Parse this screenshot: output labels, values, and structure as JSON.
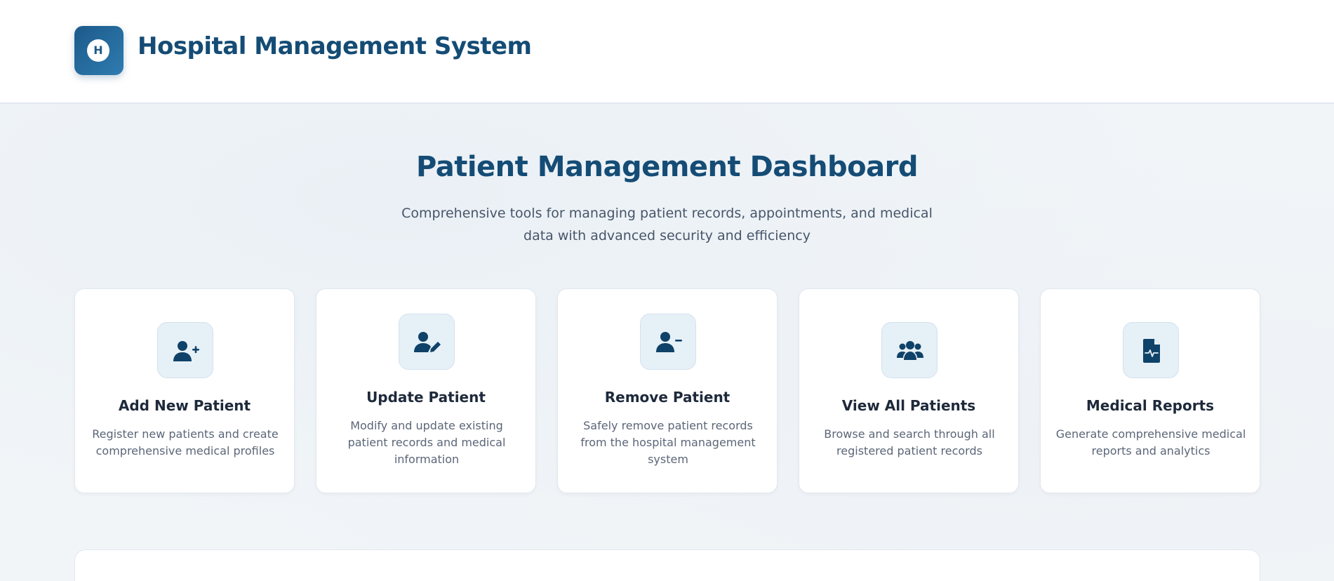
{
  "header": {
    "logo_letter": "H",
    "app_title": "Hospital Management System"
  },
  "main": {
    "title": "Patient Management Dashboard",
    "subtitle": "Comprehensive tools for managing patient records, appointments, and medical data with advanced security and efficiency"
  },
  "cards": [
    {
      "icon": "user-plus-icon",
      "title": "Add New Patient",
      "description": "Register new patients and create comprehensive medical profiles"
    },
    {
      "icon": "user-edit-icon",
      "title": "Update Patient",
      "description": "Modify and update existing patient records and medical information"
    },
    {
      "icon": "user-minus-icon",
      "title": "Remove Patient",
      "description": "Safely remove patient records from the hospital management system"
    },
    {
      "icon": "users-icon",
      "title": "View All Patients",
      "description": "Browse and search through all registered patient records"
    },
    {
      "icon": "file-medical-icon",
      "title": "Medical Reports",
      "description": "Generate comprehensive medical reports and analytics"
    }
  ],
  "colors": {
    "brand": "#144c75",
    "icon": "#0f4268",
    "icon_bg": "#e6f0f7",
    "page_bg": "#f1f5f9"
  }
}
